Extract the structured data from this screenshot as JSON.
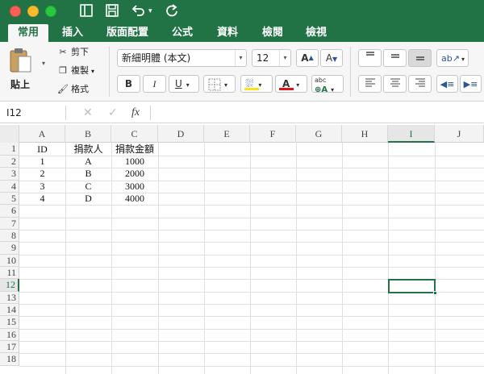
{
  "ribbon_tabs": [
    "常用",
    "插入",
    "版面配置",
    "公式",
    "資料",
    "檢閱",
    "檢視"
  ],
  "quick_access": {
    "sidebar": "⊡",
    "save": "💾",
    "undo": "↶",
    "redo": "↻"
  },
  "clipboard": {
    "paste": "貼上",
    "cut": "剪下",
    "copy": "複製",
    "format": "格式"
  },
  "font": {
    "name": "新細明體 (本文)",
    "size": "12",
    "bold": "B",
    "italic": "I",
    "underline": "U",
    "grow": "A",
    "shrink": "A",
    "color_letter": "A",
    "abc": "abc"
  },
  "colors": {
    "accent": "#217346",
    "fill_highlight": "#f9e11b",
    "font_color": "#e0131b"
  },
  "formula_bar": {
    "name_box": "I12",
    "cancel": "✕",
    "enter": "✓",
    "fx": "fx",
    "value": ""
  },
  "columns": [
    "A",
    "B",
    "C",
    "D",
    "E",
    "F",
    "G",
    "H",
    "I",
    "J"
  ],
  "rows": [
    "1",
    "2",
    "3",
    "4",
    "5",
    "6",
    "7",
    "8",
    "9",
    "10",
    "11",
    "12",
    "13",
    "14",
    "15",
    "16",
    "17",
    "18"
  ],
  "selected": {
    "column": "I",
    "row": "12"
  },
  "table": {
    "headers": [
      "ID",
      "捐款人",
      "捐款金額"
    ],
    "rows": [
      [
        "1",
        "A",
        "1000"
      ],
      [
        "2",
        "B",
        "2000"
      ],
      [
        "3",
        "C",
        "3000"
      ],
      [
        "4",
        "D",
        "4000"
      ]
    ]
  }
}
